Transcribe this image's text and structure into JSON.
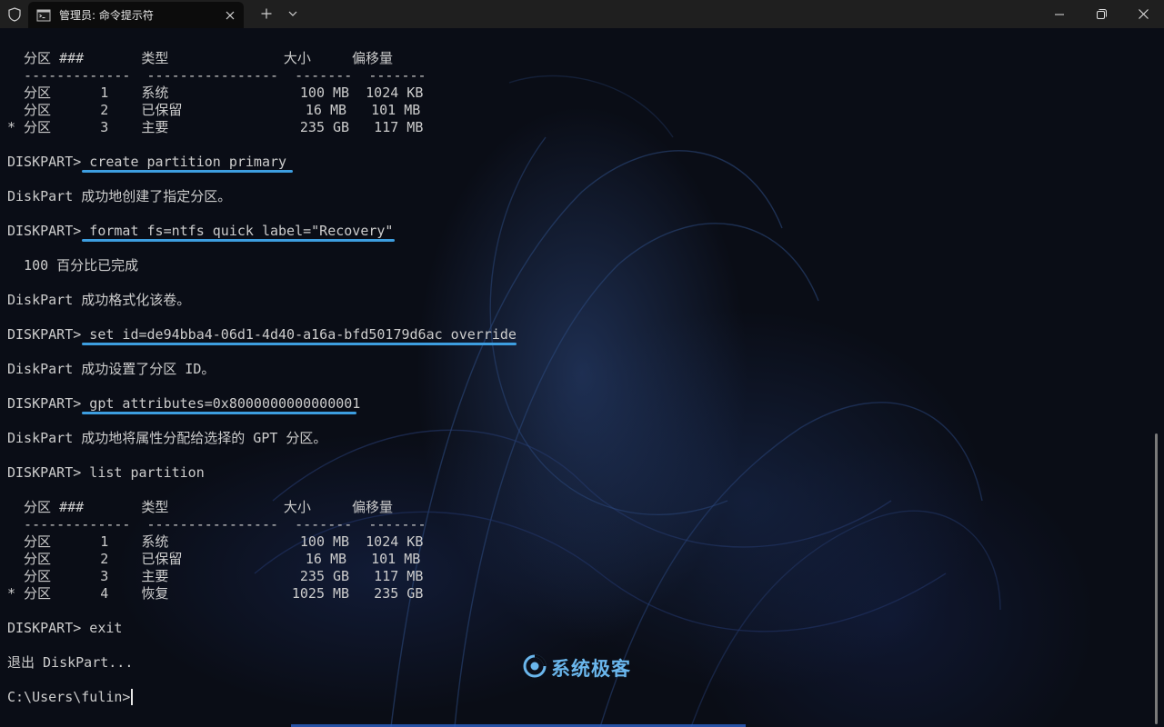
{
  "window": {
    "tab_title": "管理员: 命令提示符"
  },
  "terminal": {
    "lines": [
      "  分区 ###       类型              大小     偏移量",
      "  -------------  ----------------  -------  -------",
      "  分区      1    系统                100 MB  1024 KB",
      "  分区      2    已保留               16 MB   101 MB",
      "* 分区      3    主要                235 GB   117 MB",
      "",
      "DISKPART> create partition primary",
      "",
      "DiskPart 成功地创建了指定分区。",
      "",
      "DISKPART> format fs=ntfs quick label=\"Recovery\"",
      "",
      "  100 百分比已完成",
      "",
      "DiskPart 成功格式化该卷。",
      "",
      "DISKPART> set id=de94bba4-06d1-4d40-a16a-bfd50179d6ac override",
      "",
      "DiskPart 成功设置了分区 ID。",
      "",
      "DISKPART> gpt attributes=0x8000000000000001",
      "",
      "DiskPart 成功地将属性分配给选择的 GPT 分区。",
      "",
      "DISKPART> list partition",
      "",
      "  分区 ###       类型              大小     偏移量",
      "  -------------  ----------------  -------  -------",
      "  分区      1    系统                100 MB  1024 KB",
      "  分区      2    已保留               16 MB   101 MB",
      "  分区      3    主要                235 GB   117 MB",
      "* 分区      4    恢复               1025 MB   235 GB",
      "",
      "DISKPART> exit",
      "",
      "退出 DiskPart...",
      "",
      "C:\\Users\\fulin>"
    ]
  },
  "watermark": {
    "text": "系统极客"
  },
  "colors": {
    "accent_underline": "#3d9ee0",
    "terminal_text": "#cccccc",
    "titlebar_bg": "#1f1f1f"
  },
  "icons": {
    "shield": "shield-icon",
    "tab": "cmd-icon",
    "close": "close-icon",
    "new_tab": "plus-icon",
    "dropdown": "chevron-down-icon",
    "minimize": "minimize-icon",
    "maximize": "restore-icon",
    "window_close": "window-close-icon"
  }
}
